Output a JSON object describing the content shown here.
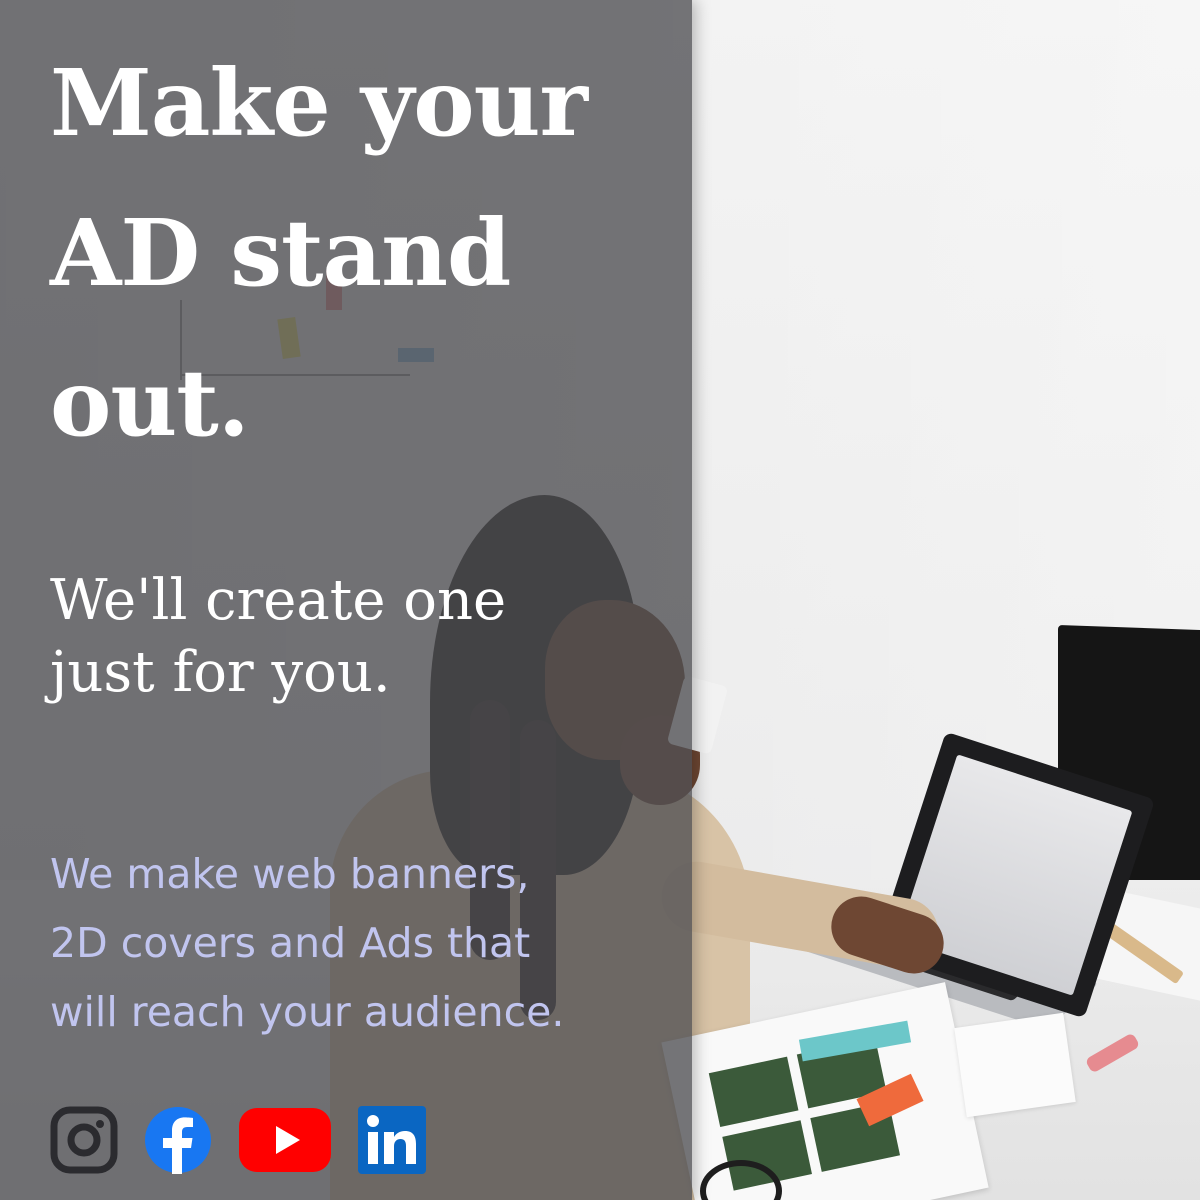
{
  "headline": {
    "line1": "Make your",
    "line2": "AD stand",
    "line3": "out."
  },
  "subhead": {
    "line1": "We'll create one",
    "line2": "just for you."
  },
  "body": {
    "line1": "We make web banners,",
    "line2": "2D covers and Ads that",
    "line3": "will reach your audience."
  },
  "social": {
    "icons": [
      "instagram-icon",
      "facebook-icon",
      "youtube-icon",
      "linkedin-icon"
    ]
  },
  "colors": {
    "overlay": "#4e4e52",
    "headline": "#ffffff",
    "body_text": "#c1c5ef",
    "facebook": "#1877f2",
    "youtube": "#ff0000",
    "linkedin": "#0a66c2",
    "instagram": "#2b2b2f"
  }
}
